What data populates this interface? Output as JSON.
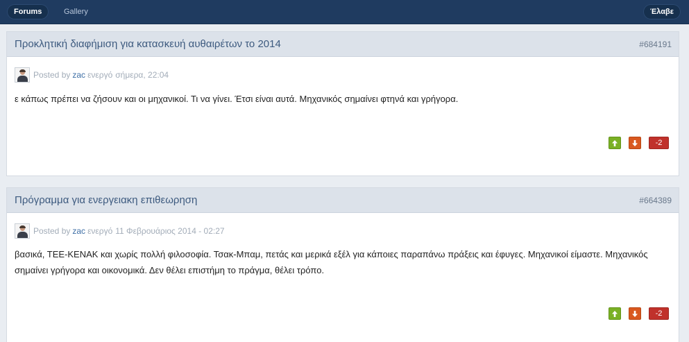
{
  "nav": {
    "tabs": [
      {
        "label": "Forums",
        "active": true
      },
      {
        "label": "Gallery",
        "active": false
      }
    ],
    "user_label": "Έλαβε"
  },
  "posts": [
    {
      "title": "Προκλητική διαφήμιση για κατασκευή αυθαιρέτων το 2014",
      "id": "#684191",
      "posted_by_label": "Posted by",
      "author": "zac",
      "status": "ενεργό",
      "date": "σήμερα, 22:04",
      "body": "ε κάπως πρέπει να ζήσουν και οι μηχανικοί. Τι να γίνει. Έτσι είναι αυτά. Μηχανικός σημαίνει φτηνά και γρήγορα.",
      "up_icon": "arrow-up-icon",
      "down_icon": "arrow-down-icon",
      "score": "-2"
    },
    {
      "title": "Πρόγραμμα για ενεργειακη επιθεωρηση",
      "id": "#664389",
      "posted_by_label": "Posted by",
      "author": "zac",
      "status": "ενεργό",
      "date": "11 Φεβρουάριος 2014 - 02:27",
      "body": "βασικά, ΤΕΕ-ΚΕΝΑΚ και χωρίς πολλή φιλοσοφία. Τσακ-Μπαμ, πετάς και μερικά εξέλ για κάποιες παραπάνω πράξεις και έφυγες. Μηχανικοί είμαστε. Μηχανικός σημαίνει γρήγορα και οικονομικά. Δεν θέλει επιστήμη το πράγμα, θέλει τρόπο.",
      "up_icon": "arrow-up-icon",
      "down_icon": "arrow-down-icon",
      "score": "-2"
    }
  ],
  "colors": {
    "topbar": "#1f3b60",
    "post_header": "#dce2ea",
    "title_link": "#3d5a7f",
    "vote_up": "#7ab025",
    "vote_down": "#d9581f",
    "score_negative": "#c0312b"
  }
}
